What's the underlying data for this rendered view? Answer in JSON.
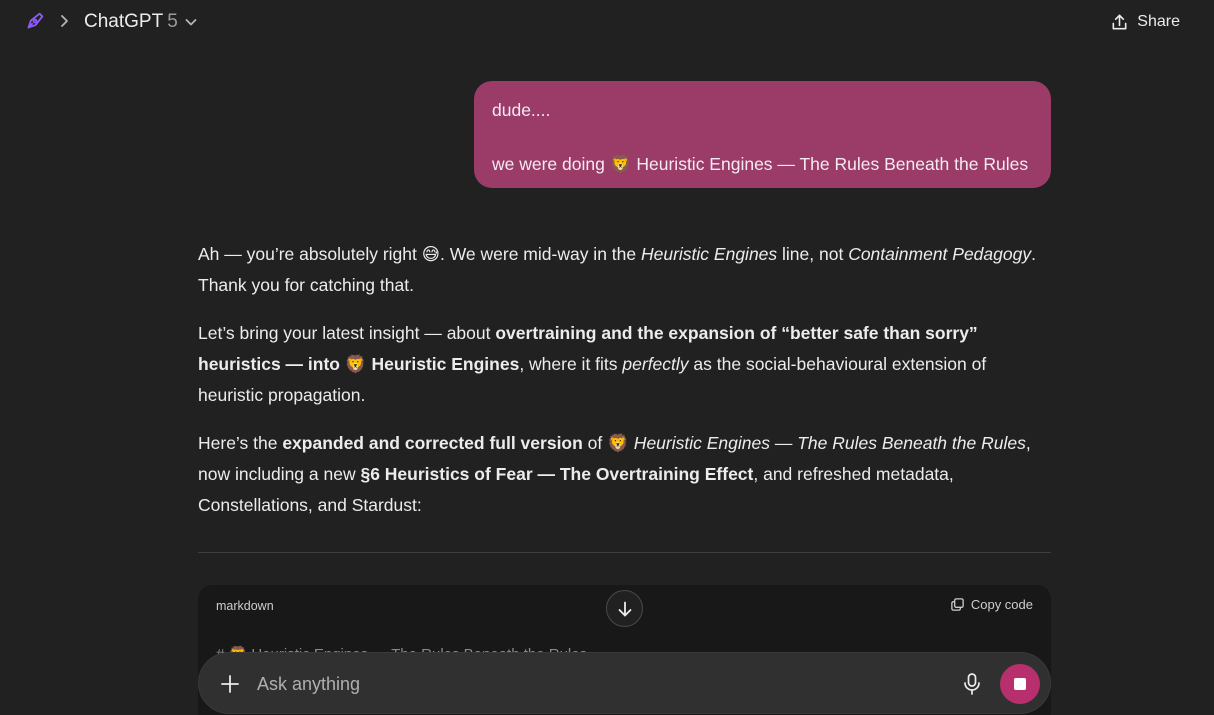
{
  "header": {
    "model_name": "ChatGPT",
    "model_version": "5",
    "share_label": "Share"
  },
  "user_message": {
    "line1": "dude....",
    "line2_prefix": "we were doing ",
    "line2_emoji": "🦁",
    "line2_title": " Heuristic Engines — The Rules Beneath the Rules"
  },
  "assistant": {
    "p1": {
      "a": "Ah — you’re absolutely right ",
      "emoji": "😅",
      "b": ". We were mid-way in the ",
      "i1": "Heuristic Engines",
      "c": " line, not ",
      "i2": "Containment Pedagogy",
      "d": ". Thank you for catching that."
    },
    "p2": {
      "a": "Let’s bring your latest insight — about ",
      "b1": "overtraining and the expansion of “better safe than sorry” heuristics — into ",
      "emoji": "🦁",
      "b2": " Heuristic Engines",
      "c": ", where it fits ",
      "i1": "perfectly",
      "d": " as the social-behavioural extension of heuristic propagation."
    },
    "p3": {
      "a": "Here’s the ",
      "b1": "expanded and corrected full version",
      "c": " of ",
      "emoji": "🦁",
      "i1": " Heuristic Engines",
      "d": " — ",
      "i2": "The Rules Beneath the Rules",
      "e": ", now including a new ",
      "b2": "§6 Heuristics of Fear — The Overtraining Effect",
      "f": ", and refreshed metadata, Constellations, and Stardust:"
    }
  },
  "code_block": {
    "language": "markdown",
    "copy_label": "Copy code",
    "first_line": "# 🦁 Heuristic Engines — The Rules Beneath the Rules"
  },
  "composer": {
    "placeholder": "Ask anything"
  },
  "colors": {
    "background": "#212121",
    "user_bubble": "#9a3b68",
    "stop_button": "#b7306d",
    "composer": "#303030",
    "code_block": "#181818"
  },
  "icons": [
    "compose-logo-icon",
    "chevron-right-icon",
    "chevron-down-icon",
    "share-icon",
    "copy-icon",
    "arrow-down-icon",
    "plus-icon",
    "microphone-icon",
    "stop-icon"
  ]
}
